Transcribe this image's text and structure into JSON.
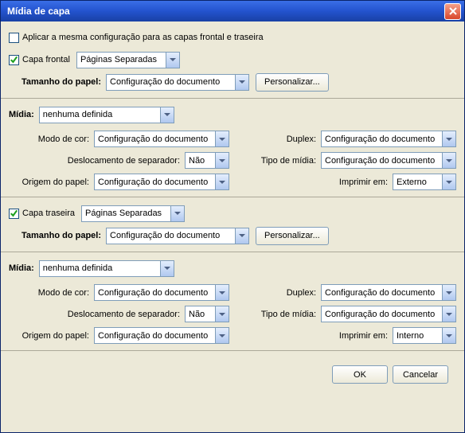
{
  "title": "Mídia de capa",
  "apply_same_label": "Aplicar a mesma configuração para as capas frontal e traseira",
  "apply_same_checked": false,
  "front": {
    "checkbox_label": "Capa frontal",
    "checked": true,
    "mode": "Páginas Separadas",
    "papersize_label": "Tamanho do papel:",
    "papersize_value": "Configuração do documento",
    "customize_label": "Personalizar...",
    "media_label": "Mídia:",
    "media_value": "nenhuma definida",
    "color_mode_label": "Modo de cor:",
    "color_mode_value": "Configuração do documento",
    "duplex_label": "Duplex:",
    "duplex_value": "Configuração do documento",
    "sep_offset_label": "Deslocamento de separador:",
    "sep_offset_value": "Não",
    "media_type_label": "Tipo de mídia:",
    "media_type_value": "Configuração do documento",
    "paper_origin_label": "Origem do papel:",
    "paper_origin_value": "Configuração do documento",
    "print_on_label": "Imprimir em:",
    "print_on_value": "Externo"
  },
  "back": {
    "checkbox_label": "Capa traseira",
    "checked": true,
    "mode": "Páginas Separadas",
    "papersize_label": "Tamanho do papel:",
    "papersize_value": "Configuração do documento",
    "customize_label": "Personalizar...",
    "media_label": "Mídia:",
    "media_value": "nenhuma definida",
    "color_mode_label": "Modo de cor:",
    "color_mode_value": "Configuração do documento",
    "duplex_label": "Duplex:",
    "duplex_value": "Configuração do documento",
    "sep_offset_label": "Deslocamento de separador:",
    "sep_offset_value": "Não",
    "media_type_label": "Tipo de mídia:",
    "media_type_value": "Configuração do documento",
    "paper_origin_label": "Origem do papel:",
    "paper_origin_value": "Configuração do documento",
    "print_on_label": "Imprimir em:",
    "print_on_value": "Interno"
  },
  "buttons": {
    "ok": "OK",
    "cancel": "Cancelar"
  }
}
